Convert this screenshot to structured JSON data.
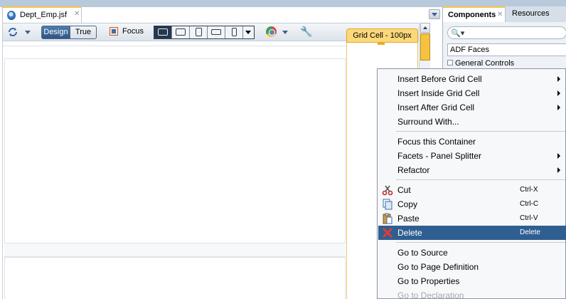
{
  "editor": {
    "tab_title": "Dept_Emp.jsf",
    "tab_close": "✕",
    "toolbar": {
      "design_label": "Design",
      "true_label": "True",
      "focus_label": "Focus"
    },
    "grid_cell_label": "Grid Cell - 100px"
  },
  "dock": {
    "tab_components": "Components",
    "tab_resources": "Resources",
    "close": "✕",
    "search_placeholder": "",
    "library": "ADF Faces",
    "tree_item": "General Controls"
  },
  "context_menu": {
    "items": [
      {
        "label": "Insert Before Grid Cell",
        "submenu": true
      },
      {
        "label": "Insert Inside Grid Cell",
        "submenu": true
      },
      {
        "label": "Insert After Grid Cell",
        "submenu": true
      },
      {
        "label": "Surround With..."
      },
      {
        "label": "Focus this Container"
      },
      {
        "label": "Facets - Panel Splitter",
        "submenu": true
      },
      {
        "label": "Refactor",
        "submenu": true
      },
      {
        "label": "Cut",
        "shortcut": "Ctrl-X",
        "icon": "scissors-icon"
      },
      {
        "label": "Copy",
        "shortcut": "Ctrl-C",
        "icon": "copy-icon"
      },
      {
        "label": "Paste",
        "shortcut": "Ctrl-V",
        "icon": "paste-icon"
      },
      {
        "label": "Delete",
        "shortcut": "Delete",
        "icon": "delete-x-icon",
        "selected": true
      },
      {
        "label": "Go to Source"
      },
      {
        "label": "Go to Page Definition"
      },
      {
        "label": "Go to Properties"
      },
      {
        "label": "Go to Declaration",
        "disabled": true
      }
    ]
  },
  "colors": {
    "selection": "#2f5f91",
    "grid_cell_header": "#fbd879",
    "tab_accent": "#f4c64a"
  }
}
